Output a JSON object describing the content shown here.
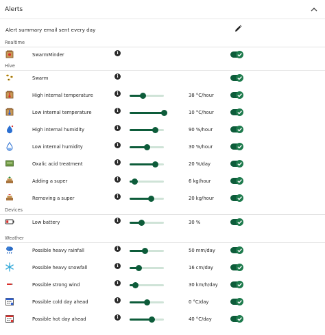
{
  "header": {
    "title": "Alerts",
    "collapse_icon": "chevron-up-icon"
  },
  "summary": {
    "label": "Alert summary email sent every day",
    "edit_icon": "pencil-icon"
  },
  "colors": {
    "accent": "#0d5c3a",
    "track": "#cfe3d7",
    "toggle_knob": "#1d7a4c"
  },
  "sections": [
    {
      "label": "Realtime",
      "rows": [
        {
          "label": "SwarmMinder",
          "icon": "hive-alarm-icon",
          "enabled": true
        }
      ]
    },
    {
      "label": "Hive",
      "rows": [
        {
          "label": "Swarm",
          "icon": "swarm-bees-icon",
          "enabled": true
        },
        {
          "label": "High internal temperature",
          "icon": "hive-temperature-high-icon",
          "value": "38 °C/hour",
          "level": 0.38,
          "enabled": true
        },
        {
          "label": "Low internal temperature",
          "icon": "hive-temperature-low-icon",
          "value": "10 °C/hour",
          "level": 1.0,
          "enabled": true
        },
        {
          "label": "High internal humidity",
          "icon": "humidity-high-icon",
          "value": "90 %/hour",
          "level": 0.75,
          "enabled": true
        },
        {
          "label": "Low internal humidity",
          "icon": "humidity-low-icon",
          "value": "30 %/hour",
          "level": 0.5,
          "enabled": true
        },
        {
          "label": "Oxalic acid treatment",
          "icon": "treatment-icon",
          "value": "20 %/day",
          "level": 0.75,
          "enabled": true
        },
        {
          "label": "Adding a super",
          "icon": "add-super-icon",
          "value": "6 kg/hour",
          "level": 0.15,
          "enabled": true
        },
        {
          "label": "Removing a super",
          "icon": "remove-super-icon",
          "value": "20 kg/hour",
          "level": 0.63,
          "enabled": true
        }
      ]
    },
    {
      "label": "Devices",
      "rows": [
        {
          "label": "Low battery",
          "icon": "battery-low-icon",
          "value": "30 %",
          "level": 0.35,
          "enabled": true
        }
      ]
    },
    {
      "label": "Weather",
      "rows": [
        {
          "label": "Possible heavy rainfall",
          "icon": "rain-icon",
          "value": "50 mm/day",
          "level": 0.45,
          "enabled": true
        },
        {
          "label": "Possible heavy snowfall",
          "icon": "snowflake-icon",
          "value": "16 cm/day",
          "level": 0.27,
          "enabled": true
        },
        {
          "label": "Possible strong wind",
          "icon": "wind-icon",
          "value": "30 km/h/day",
          "level": 0.17,
          "enabled": true
        },
        {
          "label": "Possible cold day ahead",
          "icon": "calendar-cold-icon",
          "value": "0 °C/day",
          "level": 0.5,
          "enabled": true
        },
        {
          "label": "Possible hot day ahead",
          "icon": "calendar-hot-icon",
          "value": "40 °C/day",
          "level": 0.65,
          "enabled": true
        }
      ]
    }
  ]
}
